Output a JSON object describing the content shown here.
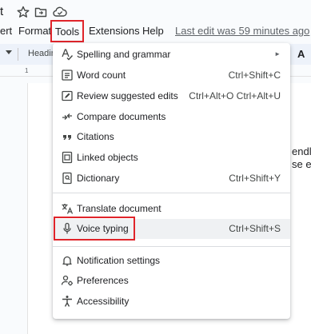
{
  "title_row": {
    "fragment": "t"
  },
  "menubar": {
    "items": [
      "ert",
      "Format",
      "Tools",
      "Extensions",
      "Help"
    ],
    "last_edit": "Last edit was 59 minutes ago"
  },
  "toolbar": {
    "style_label": "Headin",
    "right_glyph": "A"
  },
  "ruler": {
    "mark": "1"
  },
  "document": {
    "fragments": [
      "endl",
      "se era"
    ]
  },
  "tools_menu": {
    "items": [
      {
        "label": "Spelling and grammar",
        "shortcut": "",
        "icon": "spellcheck-icon",
        "submenu": true
      },
      {
        "label": "Word count",
        "shortcut": "Ctrl+Shift+C",
        "icon": "word-count-icon"
      },
      {
        "label": "Review suggested edits",
        "shortcut": "Ctrl+Alt+O Ctrl+Alt+U",
        "icon": "review-edits-icon"
      },
      {
        "label": "Compare documents",
        "shortcut": "",
        "icon": "compare-icon"
      },
      {
        "label": "Citations",
        "shortcut": "",
        "icon": "quote-icon"
      },
      {
        "label": "Linked objects",
        "shortcut": "",
        "icon": "linked-objects-icon"
      },
      {
        "label": "Dictionary",
        "shortcut": "Ctrl+Shift+Y",
        "icon": "dictionary-icon"
      },
      {
        "label": "Translate document",
        "shortcut": "",
        "icon": "translate-icon"
      },
      {
        "label": "Voice typing",
        "shortcut": "Ctrl+Shift+S",
        "icon": "microphone-icon",
        "highlighted": true
      },
      {
        "label": "Notification settings",
        "shortcut": "",
        "icon": "bell-icon"
      },
      {
        "label": "Preferences",
        "shortcut": "",
        "icon": "preferences-icon"
      },
      {
        "label": "Accessibility",
        "shortcut": "",
        "icon": "accessibility-icon"
      }
    ]
  },
  "colors": {
    "highlight_border": "#e0242a",
    "hover_row": "#eff1f3"
  }
}
